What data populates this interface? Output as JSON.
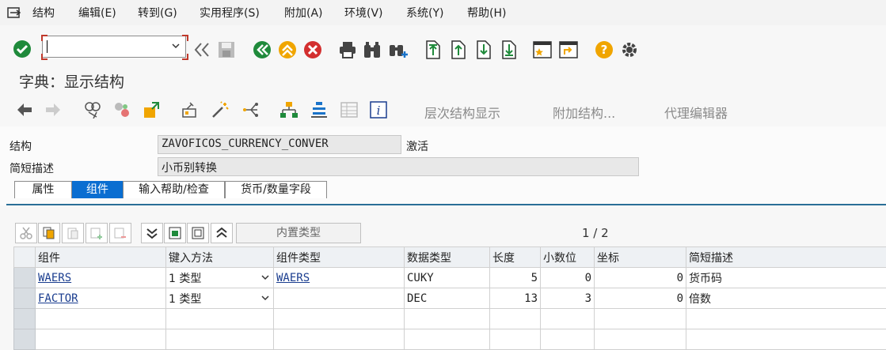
{
  "menu": [
    "结构",
    "编辑(E)",
    "转到(G)",
    "实用程序(S)",
    "附加(A)",
    "环境(V)",
    "系统(Y)",
    "帮助(H)"
  ],
  "title": "字典：显示结构",
  "toolbar2": {
    "hierarchy": "层次结构显示",
    "append": "附加结构...",
    "proxy": "代理编辑器"
  },
  "header": {
    "struct_label": "结构",
    "struct_value": "ZAVOFICOS_CURRENCY_CONVER",
    "status": "激活",
    "desc_label": "简短描述",
    "desc_value": "小币别转换"
  },
  "tabs": [
    "属性",
    "组件",
    "输入帮助/检查",
    "货币/数量字段"
  ],
  "active_tab": 1,
  "grid_toolbar": {
    "builtin_type": "内置类型",
    "pager": "1 / 2"
  },
  "columns": [
    "组件",
    "键入方法",
    "组件类型",
    "数据类型",
    "长度",
    "小数位",
    "坐标",
    "简短描述"
  ],
  "rows": [
    {
      "component": "WAERS",
      "typing": "1 类型",
      "comp_type": "WAERS",
      "data_type": "CUKY",
      "length": "5",
      "decimals": "0",
      "coord": "0",
      "desc": "货币码"
    },
    {
      "component": "FACTOR",
      "typing": "1 类型",
      "comp_type": "",
      "data_type": "DEC",
      "length": "13",
      "decimals": "3",
      "coord": "0",
      "desc": "倍数"
    }
  ],
  "colors": {
    "accent": "#0a6ed1",
    "green": "#1f8a3b",
    "red": "#d32f2f",
    "orange": "#f0a500"
  }
}
